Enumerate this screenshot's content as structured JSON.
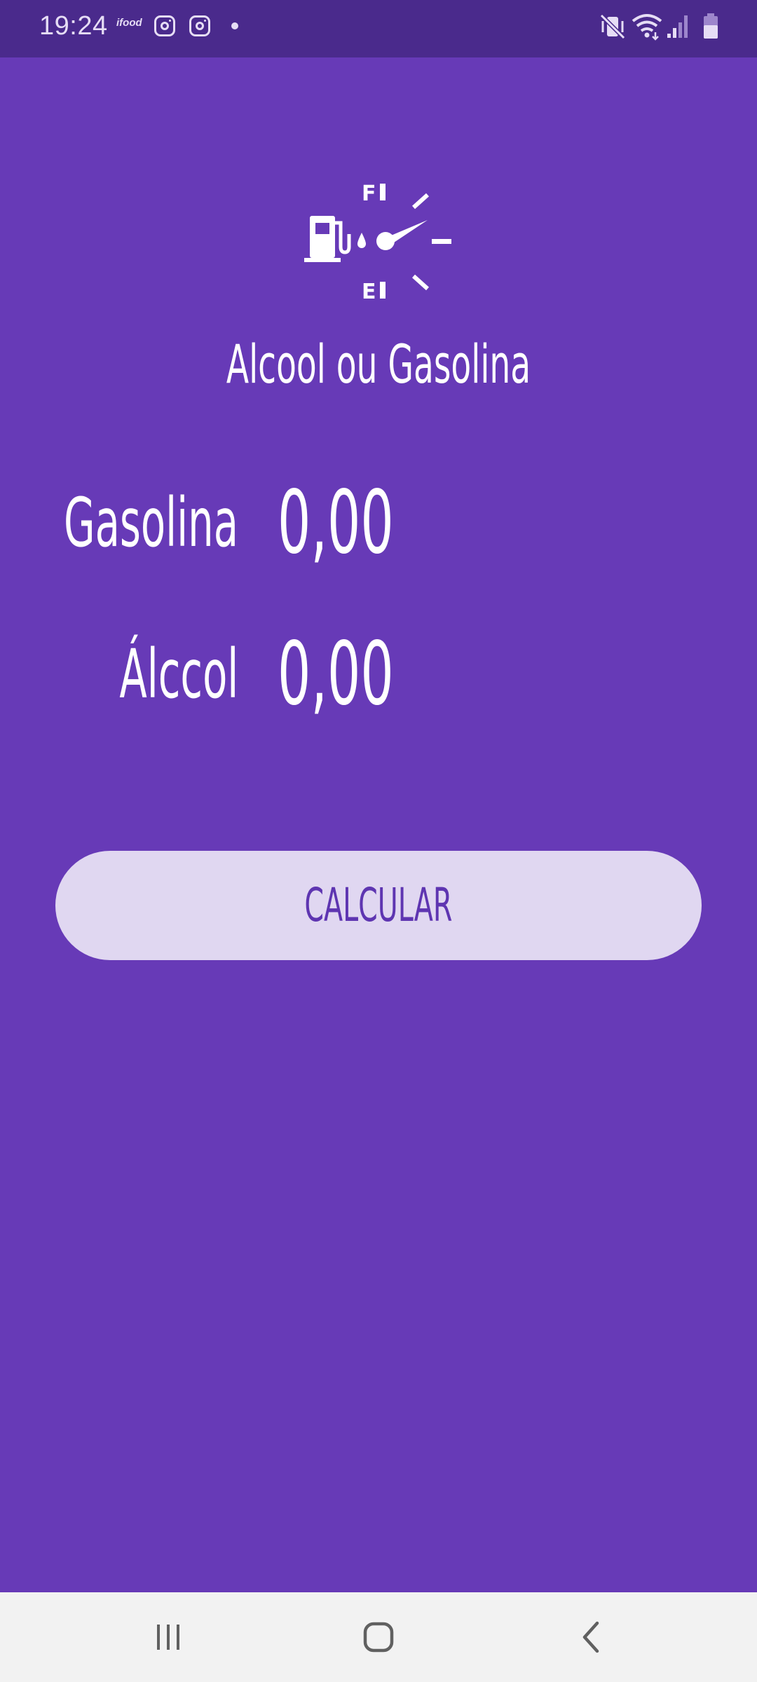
{
  "status_bar": {
    "time": "19:24",
    "notif_app_label": "ifood",
    "notification_icons": [
      "ifood-icon",
      "instagram-icon",
      "instagram-icon",
      "more-notifications-dot"
    ],
    "system_icons": [
      "vibrate-mute-icon",
      "wifi-icon",
      "signal-icon",
      "battery-icon"
    ]
  },
  "app": {
    "title": "Alcool ou Gasolina",
    "icon": "fuel-gauge-icon",
    "gauge_full_label": "F",
    "gauge_empty_label": "E",
    "fields": {
      "gasolina": {
        "label": "Gasolina",
        "value": "",
        "placeholder": "0,00"
      },
      "alcool": {
        "label": "Álccol",
        "value": "",
        "placeholder": "0,00"
      }
    },
    "calculate_label": "CALCULAR"
  },
  "colors": {
    "background": "#673ab7",
    "status_bar": "#4a2a8c",
    "button_bg": "#e0d7f1",
    "button_text": "#5e35b1",
    "nav_bar": "#f2f2f2"
  },
  "nav_bar": {
    "buttons": [
      "recent-apps-icon",
      "home-icon",
      "back-icon"
    ]
  }
}
